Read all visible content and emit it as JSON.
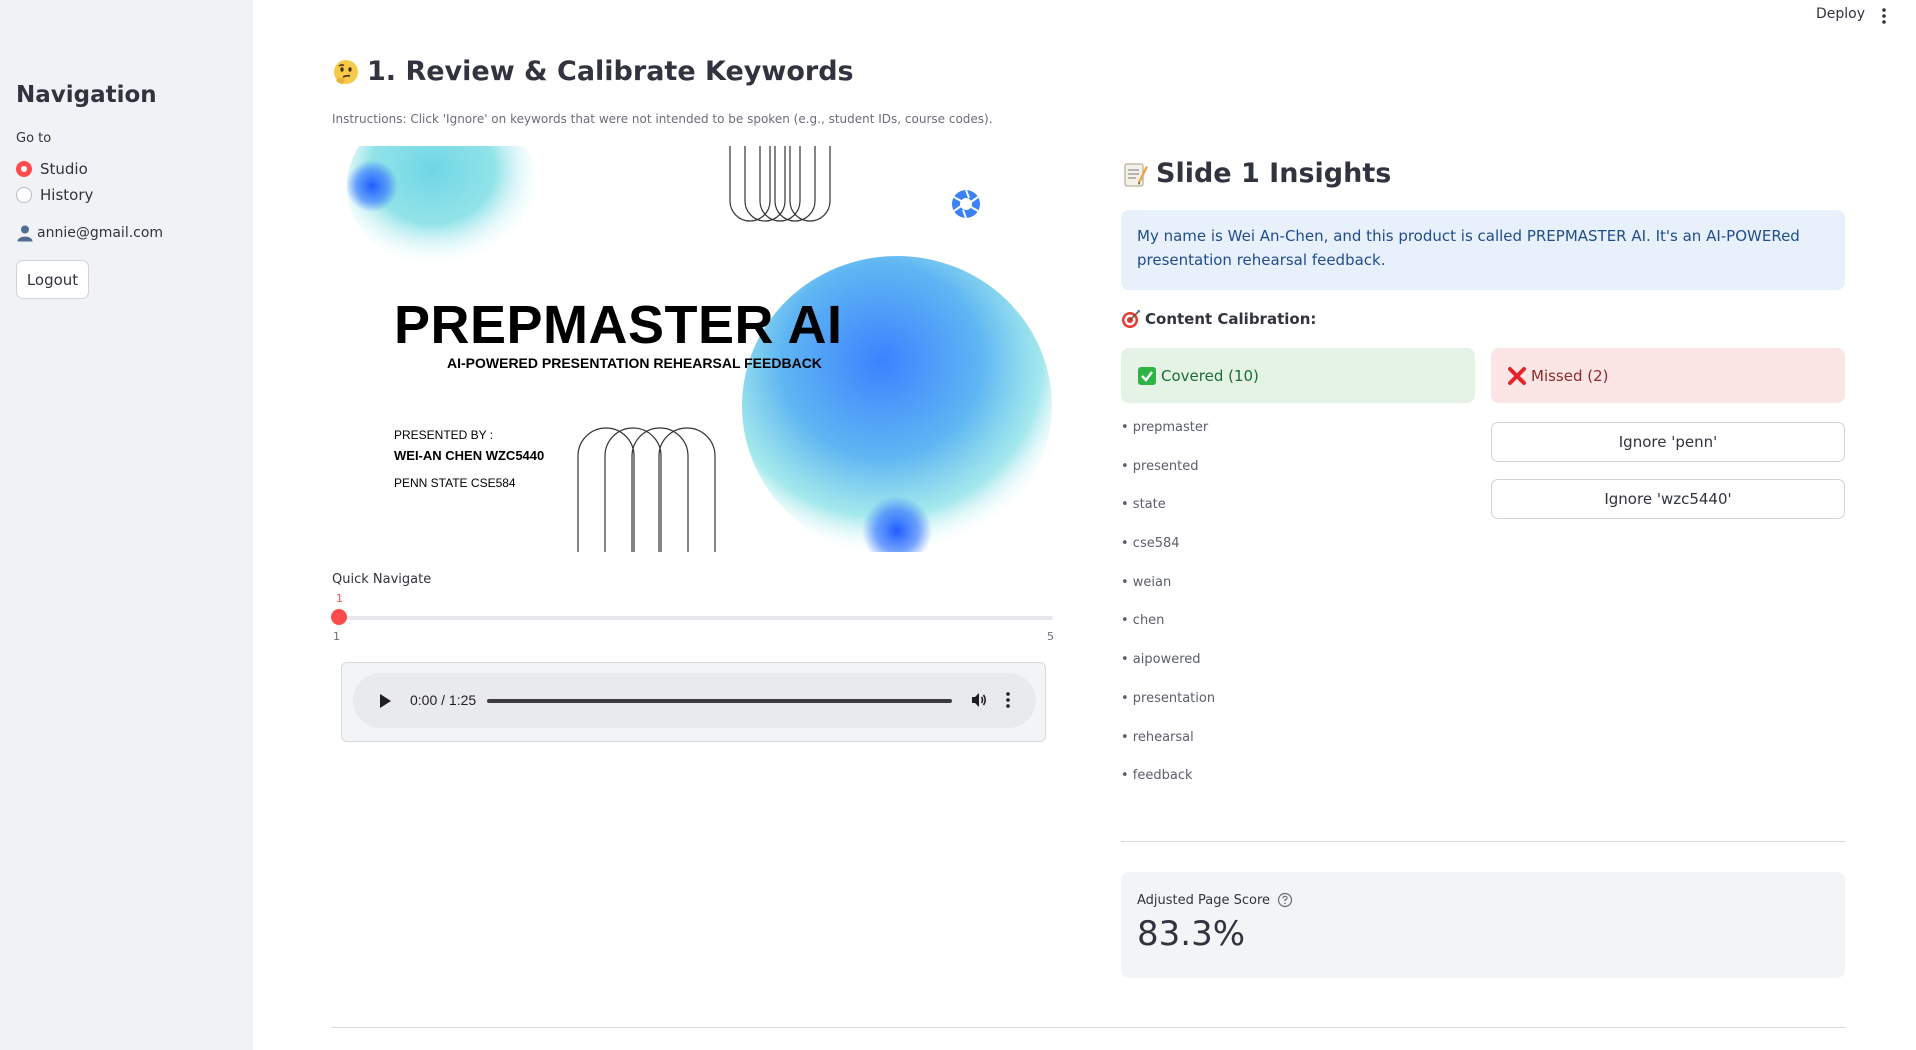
{
  "topbar": {
    "deploy_label": "Deploy"
  },
  "sidebar": {
    "title": "Navigation",
    "goto_label": "Go to",
    "options": [
      {
        "label": "Studio",
        "selected": true
      },
      {
        "label": "History",
        "selected": false
      }
    ],
    "user_email": "annie@gmail.com",
    "logout_label": "Logout"
  },
  "main": {
    "title": "1. Review & Calibrate Keywords",
    "instructions": "Instructions: Click 'Ignore' on keywords that were not intended to be spoken (e.g., student IDs, course codes)."
  },
  "slide": {
    "title": "PREPMASTER AI",
    "subtitle": "AI-POWERED PRESENTATION REHEARSAL FEEDBACK",
    "presented_by": "PRESENTED BY :",
    "presenter": "WEI-AN CHEN   WZC5440",
    "school": "PENN STATE CSE584"
  },
  "quick_navigate": {
    "label": "Quick Navigate",
    "value": "1",
    "min": "1",
    "max": "5"
  },
  "audio": {
    "time": "0:00 / 1:25",
    "progress": 0
  },
  "insights": {
    "title": "Slide 1 Insights",
    "transcript": "My name is Wei An-Chen, and this product is called PREPMASTER AI. It's an AI-POWERed presentation rehearsal feedback.",
    "calibration_title": "Content Calibration:",
    "covered_label": "Covered (10)",
    "missed_label": "Missed (2)",
    "covered_keywords": [
      "• prepmaster",
      "• presented",
      "• state",
      "• cse584",
      "• weian",
      "• chen",
      "• aipowered",
      "• presentation",
      "• rehearsal",
      "• feedback"
    ],
    "ignore_buttons": [
      "Ignore 'penn'",
      "Ignore 'wzc5440'"
    ],
    "score_label": "Adjusted Page Score",
    "score_value": "83.3%"
  },
  "colors": {
    "accent": "#ff4b4b",
    "sidebar_bg": "#f0f2f6",
    "info_bg": "#e8f0fc",
    "success_bg": "#e4f3e6",
    "error_bg": "#fbe5e5"
  }
}
